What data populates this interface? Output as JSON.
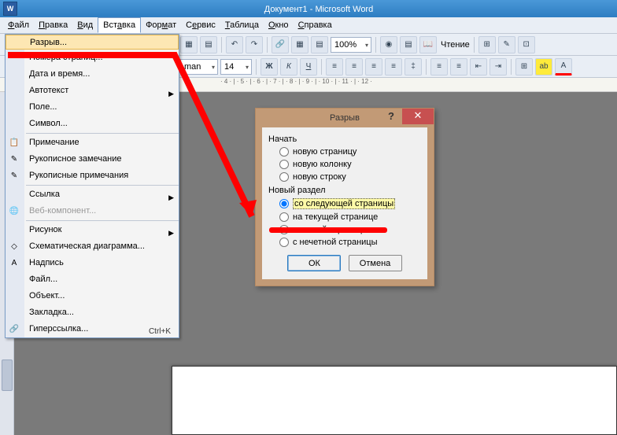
{
  "title": "Документ1 - Microsoft Word",
  "menus": {
    "file": "Файл",
    "edit": "Правка",
    "view": "Вид",
    "insert": "Вставка",
    "format": "Формат",
    "service": "Сервис",
    "table": "Таблица",
    "window": "Окно",
    "help": "Справка"
  },
  "tb": {
    "zoom": "100%",
    "reading": "Чтение",
    "font": "14",
    "fontname": "man"
  },
  "dd": {
    "razryv": "Разрыв...",
    "nomera": "Номера страниц...",
    "data": "Дата и время...",
    "avtotekst": "Автотекст",
    "pole": "Поле...",
    "simvol": "Символ...",
    "primechanie": "Примечание",
    "rukopis": "Рукописное замечание",
    "rukopisprim": "Рукописные примечания",
    "ssylka": "Ссылка",
    "webkomp": "Веб-компонент...",
    "risunok": "Рисунок",
    "shema": "Схематическая диаграмма...",
    "nadpis": "Надпись",
    "fajl": "Файл...",
    "obekt": "Объект...",
    "zakladka": "Закладка...",
    "giperssylka": "Гиперссылка...",
    "ctrlk": "Ctrl+K"
  },
  "dlg": {
    "title": "Разрыв",
    "nachat": "Начать",
    "novstr": "новую страницу",
    "novkol": "новую колонку",
    "novstroku": "новую строку",
    "novrazdel": "Новый раздел",
    "sosled": "со следующей страницы",
    "natek": "на текущей странице",
    "schet": "с четной страницы",
    "snechet": "с нечетной страницы",
    "ok": "ОК",
    "cancel": "Отмена"
  }
}
